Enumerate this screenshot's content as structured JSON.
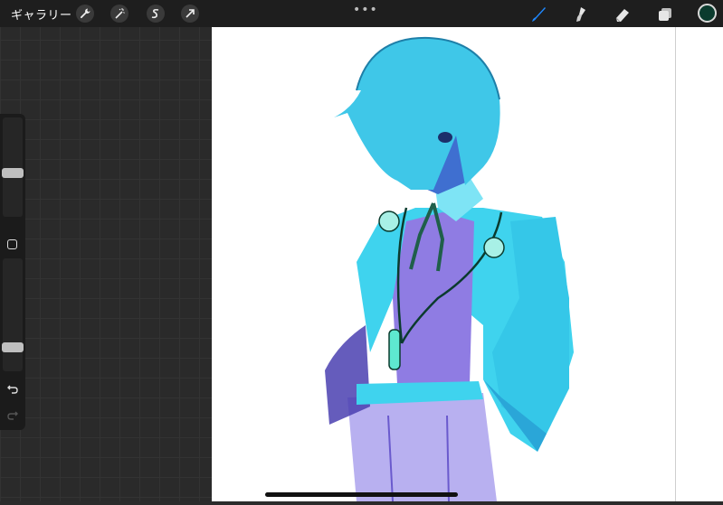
{
  "topbar": {
    "gallery_label": "ギャラリー",
    "tools_left": [
      "wrench-icon",
      "magic-wand-icon",
      "selection-s-icon",
      "transform-arrow-icon"
    ],
    "more": "•••",
    "tools_right": [
      "brush-icon",
      "smudge-icon",
      "eraser-icon",
      "layers-icon"
    ],
    "current_color": "#0b3b2e",
    "active_tool_color": "#1e88ff"
  },
  "sidebar": {
    "brush_size_level": 0.43,
    "opacity_level": 0.18
  },
  "canvas": {
    "background": "#ffffff",
    "description_color_primary": "#3fd3ee"
  }
}
